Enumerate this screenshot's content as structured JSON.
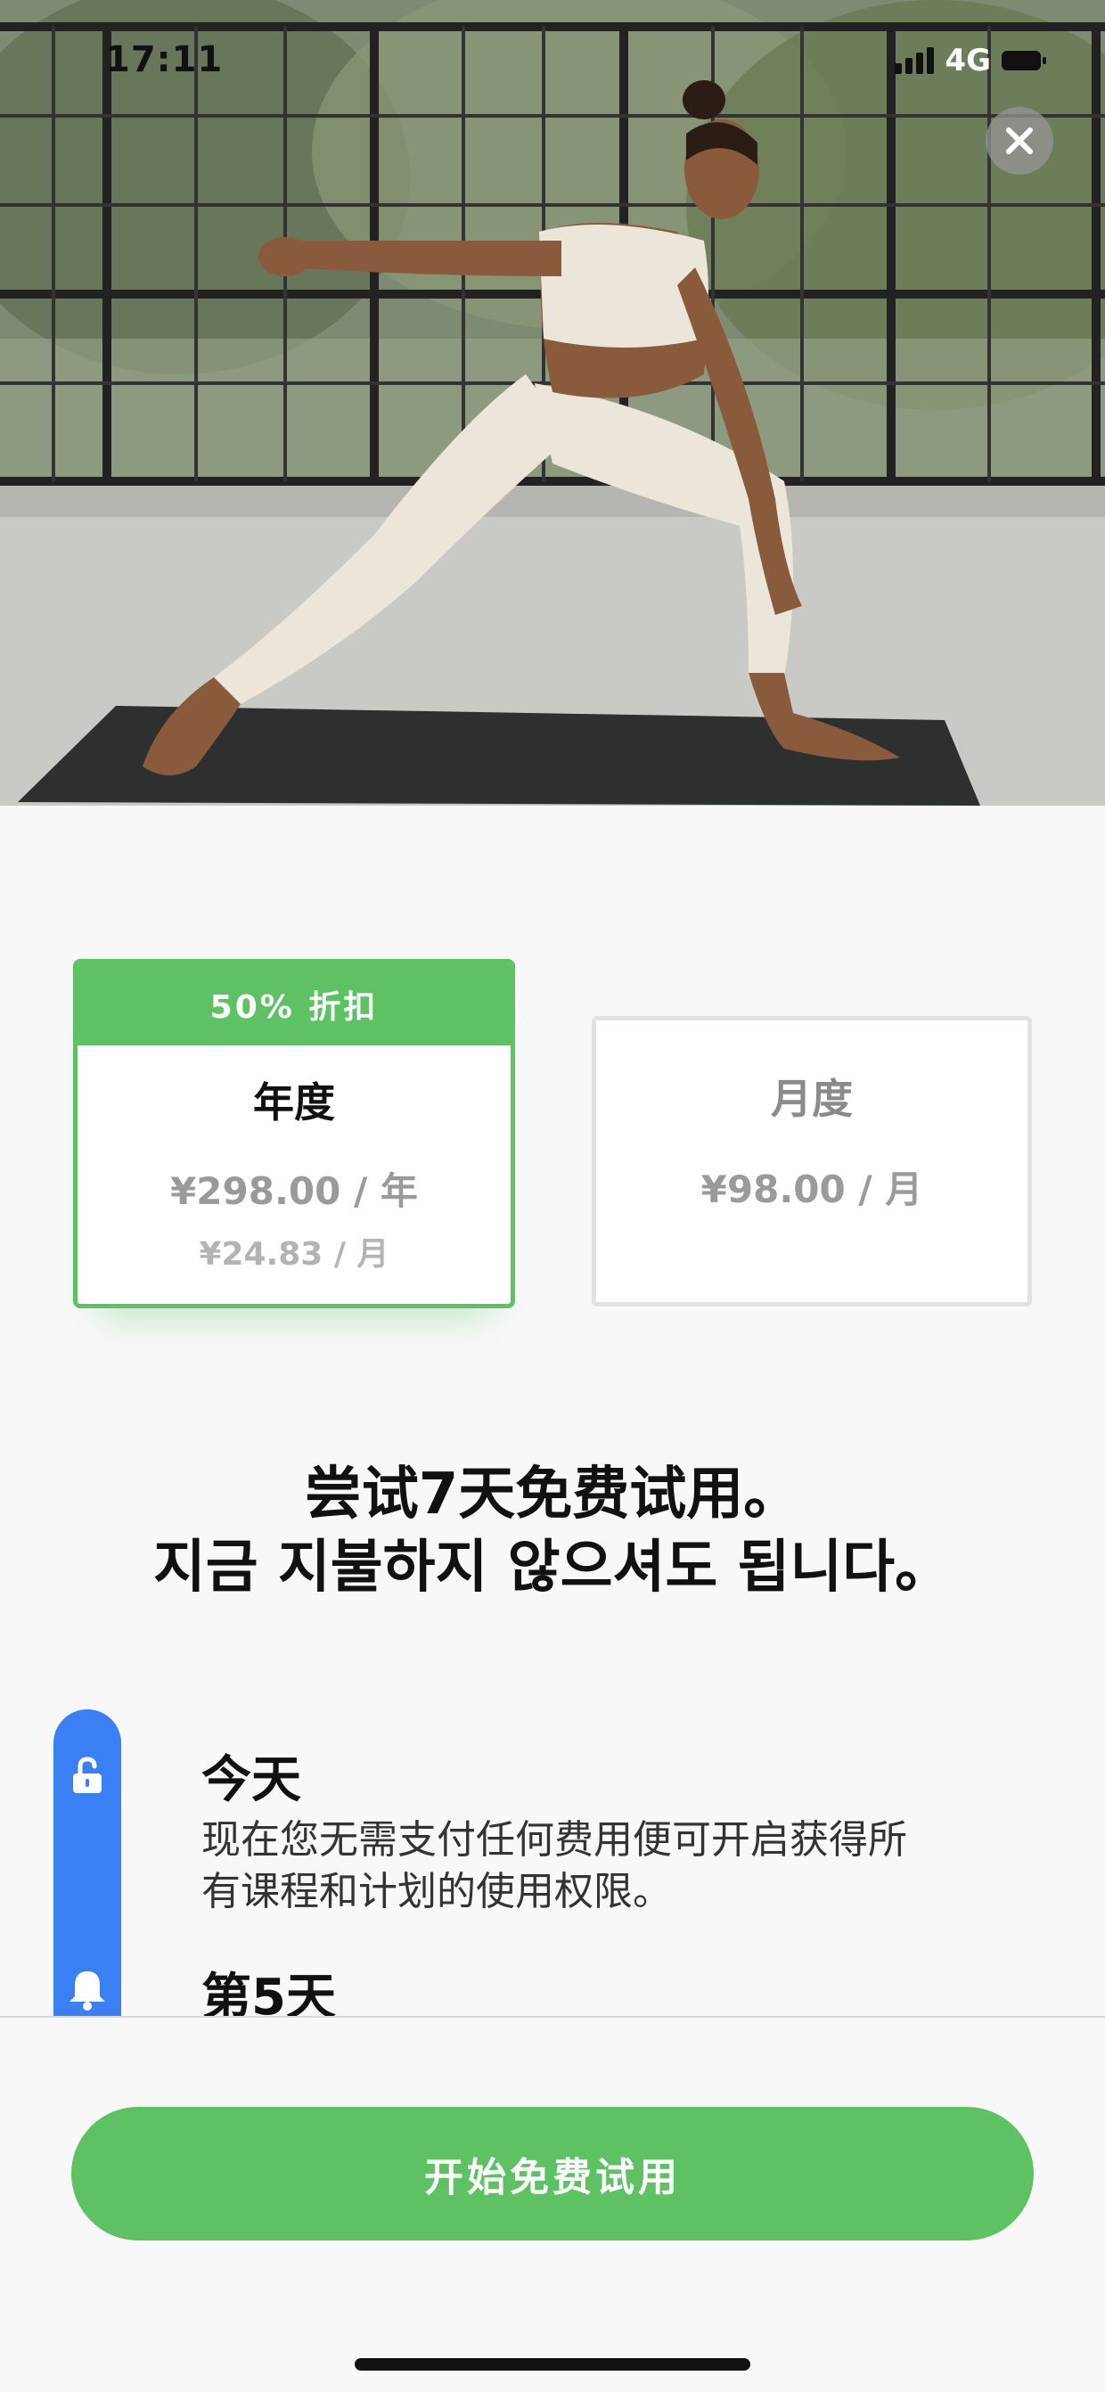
{
  "status_bar": {
    "time": "17:11",
    "network": "4G"
  },
  "hero": {
    "image": "woman-doing-yoga-warrior-pose-photo"
  },
  "plans": {
    "annual": {
      "badge": "50% 折扣",
      "title": "年度",
      "price": "¥298.00 / 年",
      "per_month": "¥24.83 / 月",
      "selected": true
    },
    "monthly": {
      "title": "月度",
      "price": "¥98.00 / 月",
      "selected": false
    }
  },
  "headline": {
    "line1": "尝试7天免费试用。",
    "line2": "지금 지불하지 않으셔도 됩니다。"
  },
  "timeline": {
    "items": [
      {
        "icon": "unlock-icon",
        "title": "今天",
        "desc_line1": "现在您无需支付任何费用便可开启获得所",
        "desc_line2": "有课程和计划的使用权限。"
      },
      {
        "icon": "bell-icon",
        "title": "第5天"
      }
    ]
  },
  "cta": {
    "label": "开始免费试用"
  },
  "colors": {
    "accent_green": "#5ec264",
    "timeline_blue": "#3b7ff5"
  }
}
